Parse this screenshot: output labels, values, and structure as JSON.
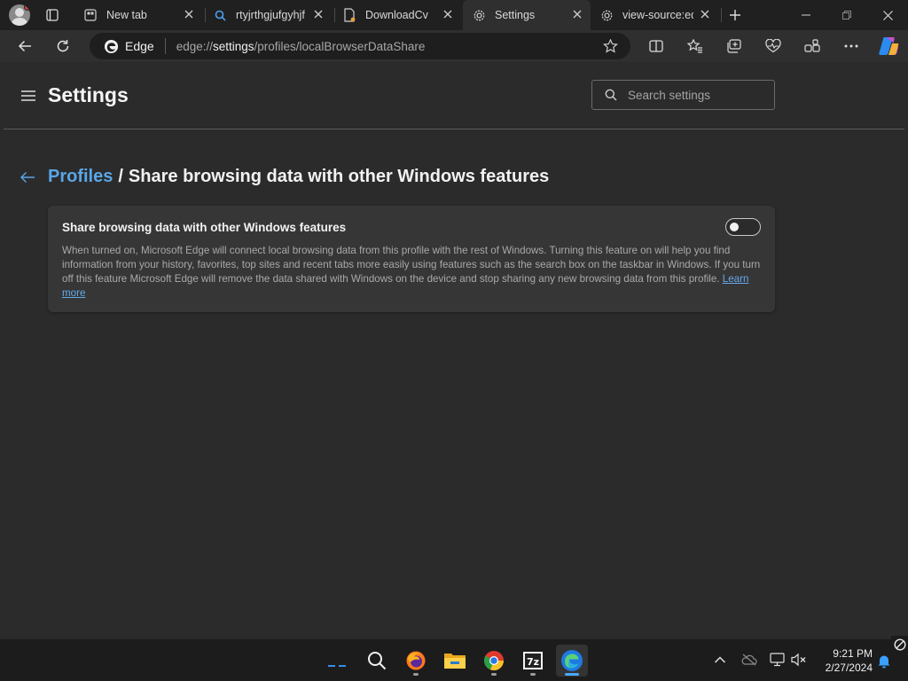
{
  "tabs": [
    {
      "label": "New tab",
      "icon": "newtab-icon"
    },
    {
      "label": "rtyjrthgjufgyhjf",
      "icon": "search-icon"
    },
    {
      "label": "DownloadCv",
      "icon": "document-icon"
    },
    {
      "label": "Settings",
      "icon": "gear-icon"
    },
    {
      "label": "view-source:ed",
      "icon": "gear-icon"
    }
  ],
  "address": {
    "chip": "Edge",
    "url_prefix": "edge://",
    "url_bold": "settings",
    "url_rest": "/profiles/localBrowserDataShare"
  },
  "page": {
    "title": "Settings",
    "search_placeholder": "Search settings",
    "breadcrumb_parent": "Profiles",
    "breadcrumb_separator": "/",
    "breadcrumb_current": "Share browsing data with other Windows features"
  },
  "card": {
    "title": "Share browsing data with other Windows features",
    "description": "When turned on, Microsoft Edge will connect local browsing data from this profile with the rest of Windows. Turning this feature on will help you find information from your history, favorites, top sites and recent tabs more easily using features such as the search box on the taskbar in Windows. If you turn off this feature Microsoft Edge will remove the data shared with Windows on the device and stop sharing any new browsing data from this profile.",
    "learn_more": "Learn more",
    "toggle_on": false
  },
  "taskbar": {
    "time": "9:21 PM",
    "date": "2/27/2024"
  },
  "colors": {
    "accent": "#5aa6e8",
    "page_bg": "#2b2b2b",
    "card_bg": "#363636"
  }
}
